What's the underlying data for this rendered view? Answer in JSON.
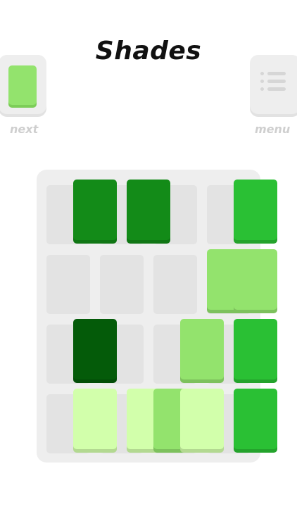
{
  "app": {
    "title": "Shades"
  },
  "next": {
    "label": "next",
    "tile_color": "#93e36d",
    "tile_shadow": "#7ccd58"
  },
  "menu": {
    "label": "menu",
    "icon": "list-icon"
  },
  "board": {
    "columns": 4,
    "rows": 4,
    "colors": {
      "shade_1": "#d2ffab",
      "shade_2": "#93e36d",
      "shade_3": "#2ac034",
      "shade_4": "#138b18",
      "shade_5": "#045b09"
    },
    "tiles": [
      {
        "col": 0,
        "row": 0,
        "shade": "shade_4"
      },
      {
        "col": 1,
        "row": 0,
        "shade": "shade_4"
      },
      {
        "col": 3,
        "row": 0,
        "shade": "shade_3"
      },
      {
        "col": 2.5,
        "row": 1,
        "shade": "shade_2"
      },
      {
        "col": 3,
        "row": 1,
        "shade": "shade_2"
      },
      {
        "col": 0,
        "row": 2,
        "shade": "shade_5"
      },
      {
        "col": 2,
        "row": 2,
        "shade": "shade_2"
      },
      {
        "col": 3,
        "row": 2,
        "shade": "shade_3"
      },
      {
        "col": 0,
        "row": 3,
        "shade": "shade_1"
      },
      {
        "col": 1,
        "row": 3,
        "shade": "shade_1"
      },
      {
        "col": 1.5,
        "row": 3,
        "shade": "shade_2"
      },
      {
        "col": 2,
        "row": 3,
        "shade": "shade_1"
      },
      {
        "col": 3,
        "row": 3,
        "shade": "shade_3"
      }
    ]
  }
}
